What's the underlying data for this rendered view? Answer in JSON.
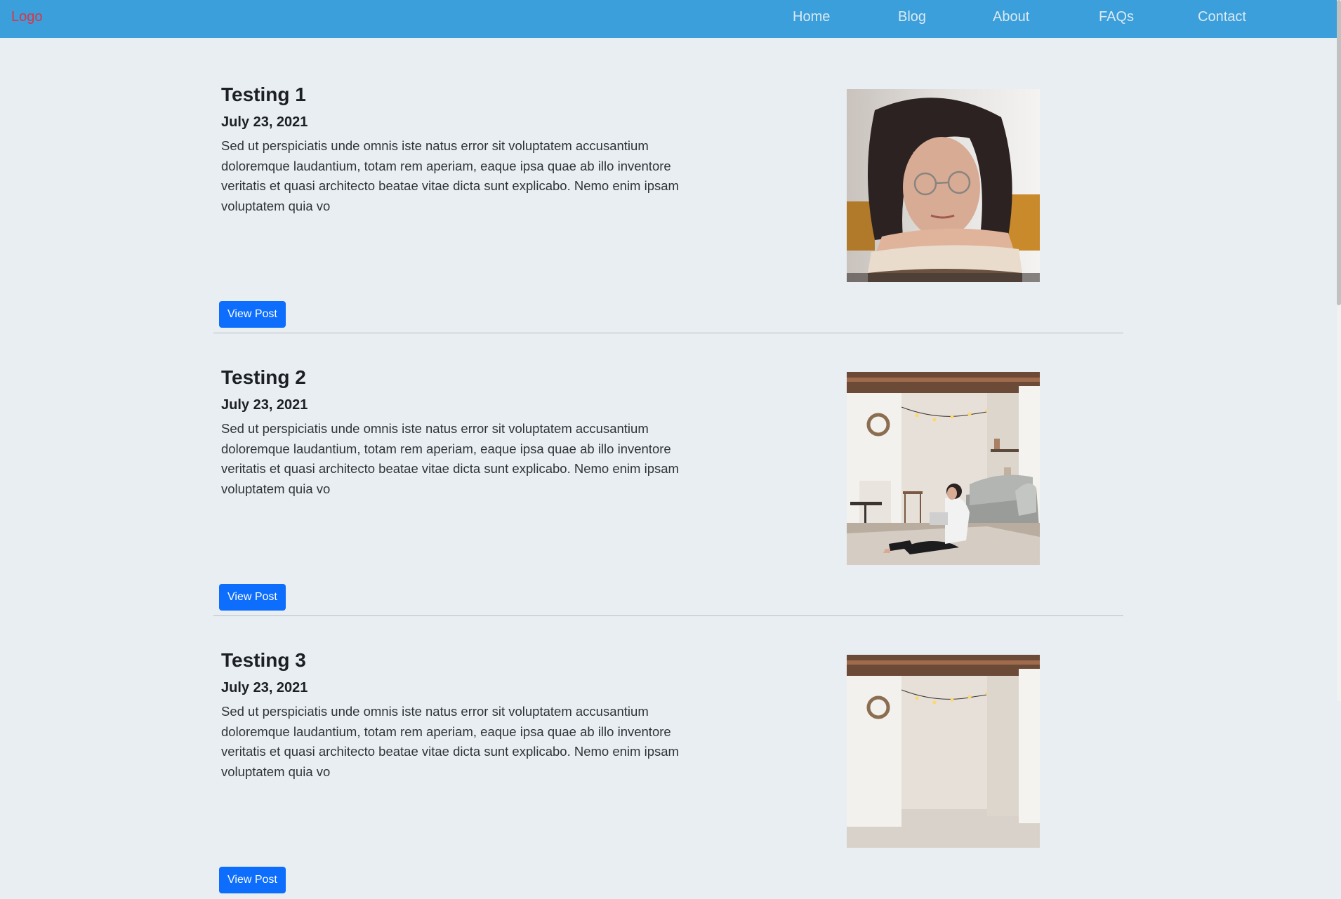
{
  "header": {
    "logo": "Logo",
    "nav": [
      "Home",
      "Blog",
      "About",
      "FAQs",
      "Contact"
    ]
  },
  "colors": {
    "nav_bg": "#3a9fdb",
    "logo": "#dc3545",
    "button": "#0d6efd",
    "page_bg": "#e8eef1"
  },
  "posts": [
    {
      "title": "Testing 1",
      "date": "July 23, 2021",
      "excerpt": "Sed ut perspiciatis unde omnis iste natus error sit voluptatem accusantium doloremque laudantium, totam rem aperiam, eaque ipsa quae ab illo inventore veritatis et quasi architecto beatae vitae dicta sunt explicabo. Nemo enim ipsam voluptatem quia vo",
      "button": "View Post",
      "image": "woman-reading-book-photo"
    },
    {
      "title": "Testing 2",
      "date": "July 23, 2021",
      "excerpt": "Sed ut perspiciatis unde omnis iste natus error sit voluptatem accusantium doloremque laudantium, totam rem aperiam, eaque ipsa quae ab illo inventore veritatis et quasi architecto beatae vitae dicta sunt explicabo. Nemo enim ipsam voluptatem quia vo",
      "button": "View Post",
      "image": "woman-on-floor-in-living-room-photo"
    },
    {
      "title": "Testing 3",
      "date": "July 23, 2021",
      "excerpt": "Sed ut perspiciatis unde omnis iste natus error sit voluptatem accusantium doloremque laudantium, totam rem aperiam, eaque ipsa quae ab illo inventore veritatis et quasi architecto beatae vitae dicta sunt explicabo. Nemo enim ipsam voluptatem quia vo",
      "button": "View Post",
      "image": "woman-on-floor-in-living-room-photo"
    }
  ]
}
